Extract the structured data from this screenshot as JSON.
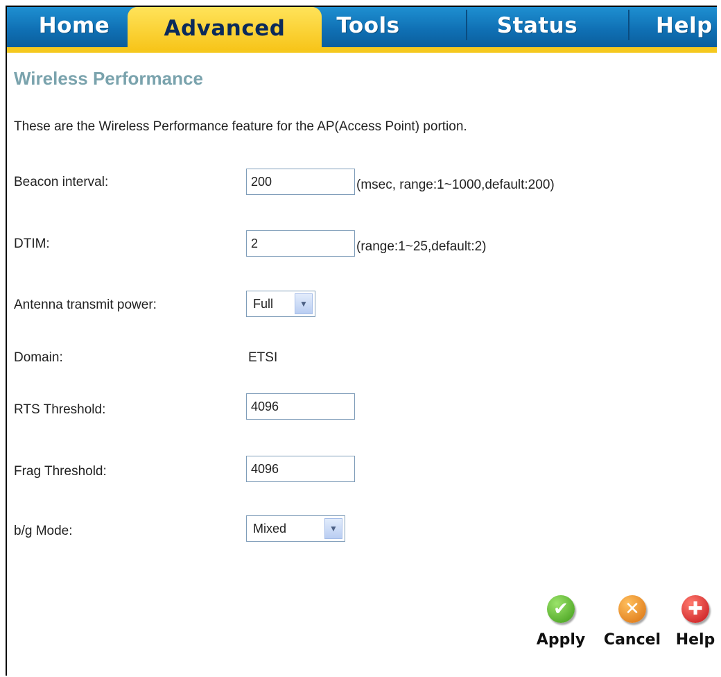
{
  "nav": {
    "tabs": [
      {
        "label": "Home",
        "active": false
      },
      {
        "label": "Advanced",
        "active": true
      },
      {
        "label": "Tools",
        "active": false
      },
      {
        "label": "Status",
        "active": false
      },
      {
        "label": "Help",
        "active": false
      }
    ]
  },
  "page": {
    "title": "Wireless Performance",
    "intro": "These are the Wireless Performance feature for the AP(Access Point) portion."
  },
  "form": {
    "beacon": {
      "label": "Beacon interval:",
      "value": "200",
      "hint": "(msec, range:1~1000,default:200)"
    },
    "dtim": {
      "label": "DTIM:",
      "value": "2",
      "hint": "(range:1~25,default:2)"
    },
    "antenna": {
      "label": "Antenna transmit power:",
      "selected": "Full"
    },
    "domain": {
      "label": "Domain:",
      "value": "ETSI"
    },
    "rts": {
      "label": "RTS Threshold:",
      "value": "4096"
    },
    "frag": {
      "label": "Frag Threshold:",
      "value": "4096"
    },
    "bg_mode": {
      "label": "b/g Mode:",
      "selected": "Mixed"
    }
  },
  "actions": {
    "apply": {
      "label": "Apply",
      "icon": "check-icon",
      "color": "#5cb82e"
    },
    "cancel": {
      "label": "Cancel",
      "icon": "x-icon",
      "color": "#e98a1f"
    },
    "help": {
      "label": "Help",
      "icon": "plus-icon",
      "color": "#d8262a"
    }
  },
  "colors": {
    "nav_blue": "#0f6fb3",
    "nav_active": "#f7c51a",
    "title": "#7aa3ad"
  }
}
